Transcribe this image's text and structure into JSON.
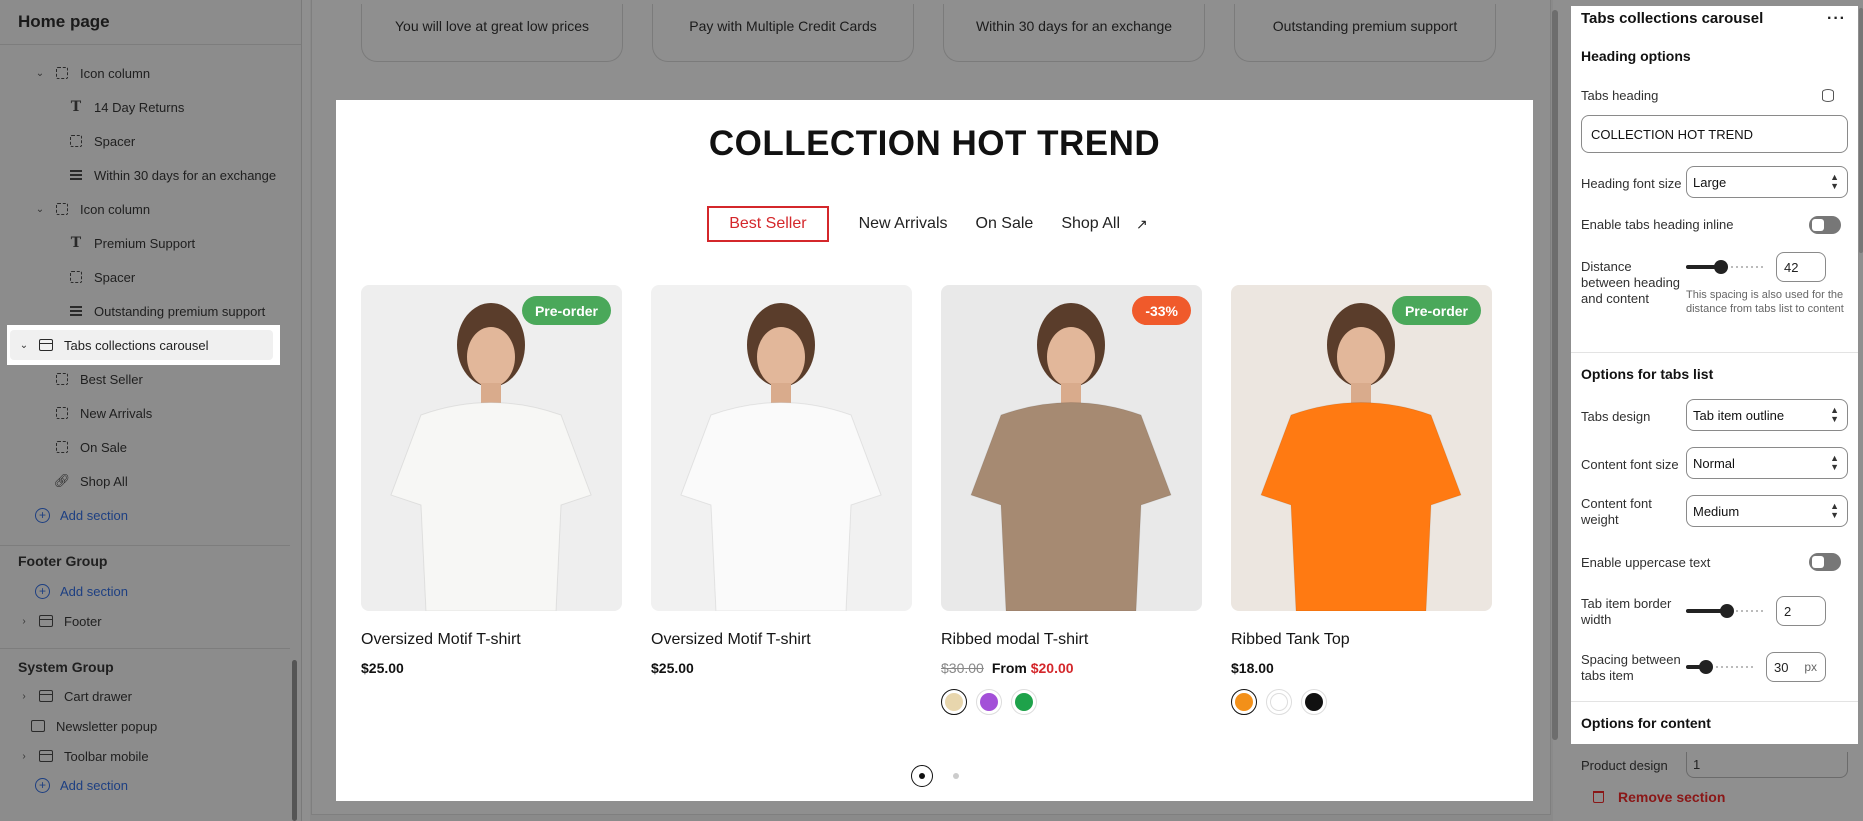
{
  "sidebar": {
    "title": "Home page",
    "tree": [
      {
        "label": "Icon column",
        "icon": "icon-column",
        "chevron": "down",
        "indent": 1
      },
      {
        "label": "14 Day Returns",
        "icon": "text-icon",
        "indent": 2
      },
      {
        "label": "Spacer",
        "icon": "icon-column",
        "indent": 2
      },
      {
        "label": "Within 30 days for an exchange",
        "icon": "paragraph-icon",
        "indent": 2
      },
      {
        "label": "Icon column",
        "icon": "icon-column",
        "chevron": "down",
        "indent": 1
      },
      {
        "label": "Premium Support",
        "icon": "text-icon",
        "indent": 2
      },
      {
        "label": "Spacer",
        "icon": "icon-column",
        "indent": 2
      },
      {
        "label": "Outstanding premium support",
        "icon": "paragraph-icon",
        "indent": 2
      },
      {
        "label": "Tabs collections carousel",
        "icon": "section-icon",
        "chevron": "down",
        "indent": 0,
        "selected": true
      },
      {
        "label": "Best Seller",
        "icon": "icon-column",
        "indent": 1
      },
      {
        "label": "New Arrivals",
        "icon": "icon-column",
        "indent": 1
      },
      {
        "label": "On Sale",
        "icon": "icon-column",
        "indent": 1
      },
      {
        "label": "Shop All",
        "icon": "link-icon",
        "indent": 1
      }
    ],
    "add_section": "Add section",
    "footer_group": {
      "title": "Footer Group",
      "add_section": "Add section",
      "footer": "Footer"
    },
    "system_group": {
      "title": "System Group",
      "cart_drawer": "Cart drawer",
      "newsletter_popup": "Newsletter popup",
      "toolbar_mobile": "Toolbar mobile",
      "add_section": "Add section"
    }
  },
  "features": [
    "You will love at great low prices",
    "Pay with Multiple Credit Cards",
    "Within 30 days for an exchange",
    "Outstanding premium support"
  ],
  "section": {
    "heading": "COLLECTION HOT TREND",
    "tabs": [
      "Best Seller",
      "New Arrivals",
      "On Sale",
      "Shop All"
    ],
    "active_tab": "Best Seller",
    "products": [
      {
        "name": "Oversized Motif T-shirt",
        "price": "$25.00",
        "badge": "Pre-order",
        "badge_color": "#4aa85a",
        "shirt": "#f7f7f5",
        "bg": "#eeeeee"
      },
      {
        "name": "Oversized Motif T-shirt",
        "price": "$25.00",
        "badge": "",
        "shirt": "#fafafa",
        "bg": "#f1f1f1"
      },
      {
        "name": "Ribbed modal T-shirt",
        "old_price": "$30.00",
        "from_label": "From",
        "price": "$20.00",
        "badge": "-33%",
        "badge_color": "#f05a2b",
        "shirt": "#a68a72",
        "bg": "#e9e9e9",
        "swatches": [
          {
            "color": "#e8d6ad",
            "selected": true
          },
          {
            "color": "#a350d8",
            "selected": false
          },
          {
            "color": "#1ea24a",
            "selected": false
          }
        ]
      },
      {
        "name": "Ribbed Tank Top",
        "price": "$18.00",
        "badge": "Pre-order",
        "badge_color": "#4aa85a",
        "shirt": "#ff7a12",
        "bg": "#ece6e0",
        "swatches": [
          {
            "color": "#f39019",
            "selected": true
          },
          {
            "color": "#ffffff",
            "selected": false
          },
          {
            "color": "#111111",
            "selected": false
          }
        ]
      }
    ]
  },
  "panel": {
    "title": "Tabs collections carousel",
    "more": "···",
    "heading_options": "Heading options",
    "tabs_heading_label": "Tabs heading",
    "tabs_heading_value": "COLLECTION HOT TREND",
    "heading_font_size_label": "Heading font size",
    "heading_font_size_value": "Large",
    "enable_inline_label": "Enable tabs heading inline",
    "distance_label": "Distance between heading and content",
    "distance_value": "42",
    "distance_fraction": 0.45,
    "distance_help": "This spacing is also used for the distance from tabs list to content",
    "tabs_list_options": "Options for tabs list",
    "tabs_design_label": "Tabs design",
    "tabs_design_value": "Tab item outline",
    "content_font_size_label": "Content font size",
    "content_font_size_value": "Normal",
    "content_font_weight_label": "Content font weight",
    "content_font_weight_value": "Medium",
    "uppercase_label": "Enable uppercase text",
    "border_width_label": "Tab item border width",
    "border_width_value": "2",
    "border_width_fraction": 0.52,
    "spacing_label": "Spacing between tabs item",
    "spacing_value": "30",
    "spacing_unit": "px",
    "spacing_fraction": 0.3,
    "content_options": "Options for content",
    "product_design_label": "Product design",
    "product_design_value": "1",
    "remove_section": "Remove section"
  }
}
